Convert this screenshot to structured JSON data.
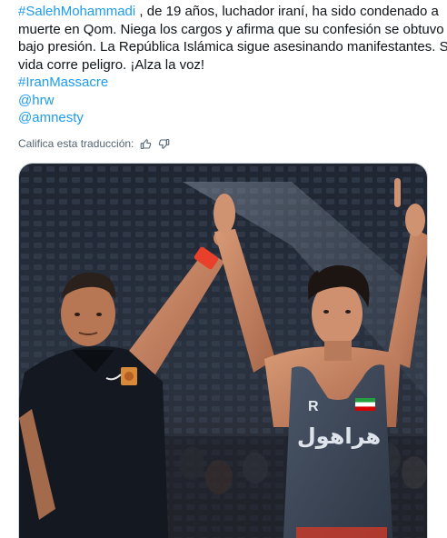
{
  "tweet": {
    "line1": {
      "hashtag": "#SalehMohammadi",
      "rest": " , de 19 años, luchador iraní, ha sido condenado a"
    },
    "line2": "muerte en Qom. Niega los cargos y afirma que su confesión se obtuvo",
    "line3": "bajo presión. La República Islámica sigue asesinando manifestantes. Su",
    "line4": "vida corre peligro. ¡Alza la voz!",
    "hashtag_iran": "#IranMassacre",
    "mention_hrw": "@hrw",
    "mention_amnesty": "@amnesty"
  },
  "translation_rating": {
    "label": "Califica esta traducción:",
    "thumbs_up_icon": "thumbs-up-icon",
    "thumbs_down_icon": "thumbs-down-icon"
  },
  "media": {
    "singlet_logo": "R",
    "singlet_text": "هراهول"
  },
  "colors": {
    "link": "#1d9bf0",
    "text": "#0f1419",
    "muted": "#536471",
    "singlet": "#3b4656",
    "referee_shirt": "#141820",
    "wristband": "#e8402a"
  }
}
